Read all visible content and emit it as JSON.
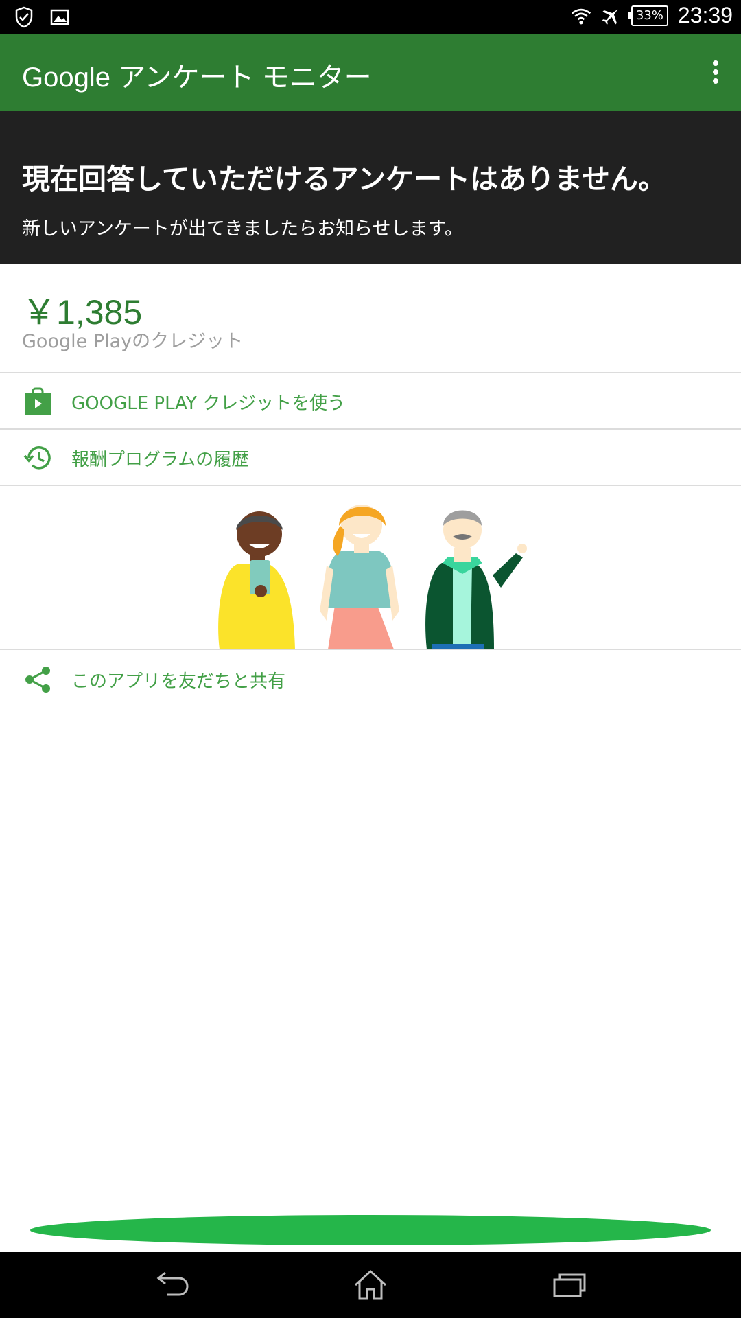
{
  "status_bar": {
    "time": "23:39",
    "battery": "33%",
    "icons": [
      "shield-check-icon",
      "image-icon",
      "wifi-icon",
      "airplane-icon",
      "battery-icon"
    ]
  },
  "app_bar": {
    "title": "Google アンケート モニター",
    "overflow_icon": "more-vert-icon"
  },
  "banner": {
    "headline": "現在回答していただけるアンケートはありません。",
    "subtext": "新しいアンケートが出てきましたらお知らせします。"
  },
  "credit": {
    "amount": "￥1,385",
    "label": "Google Playのクレジット"
  },
  "menu": {
    "use_credit": "GOOGLE PLAY クレジットを使う",
    "history": "報酬プログラムの履歴",
    "share": "このアプリを友だちと共有"
  },
  "colors": {
    "app_bar": "#2e7d32",
    "banner": "#212121",
    "accent": "#43a047",
    "cta": "#25b64a"
  },
  "nav_bar": {
    "icons": [
      "back-icon",
      "home-icon",
      "recents-icon"
    ]
  }
}
